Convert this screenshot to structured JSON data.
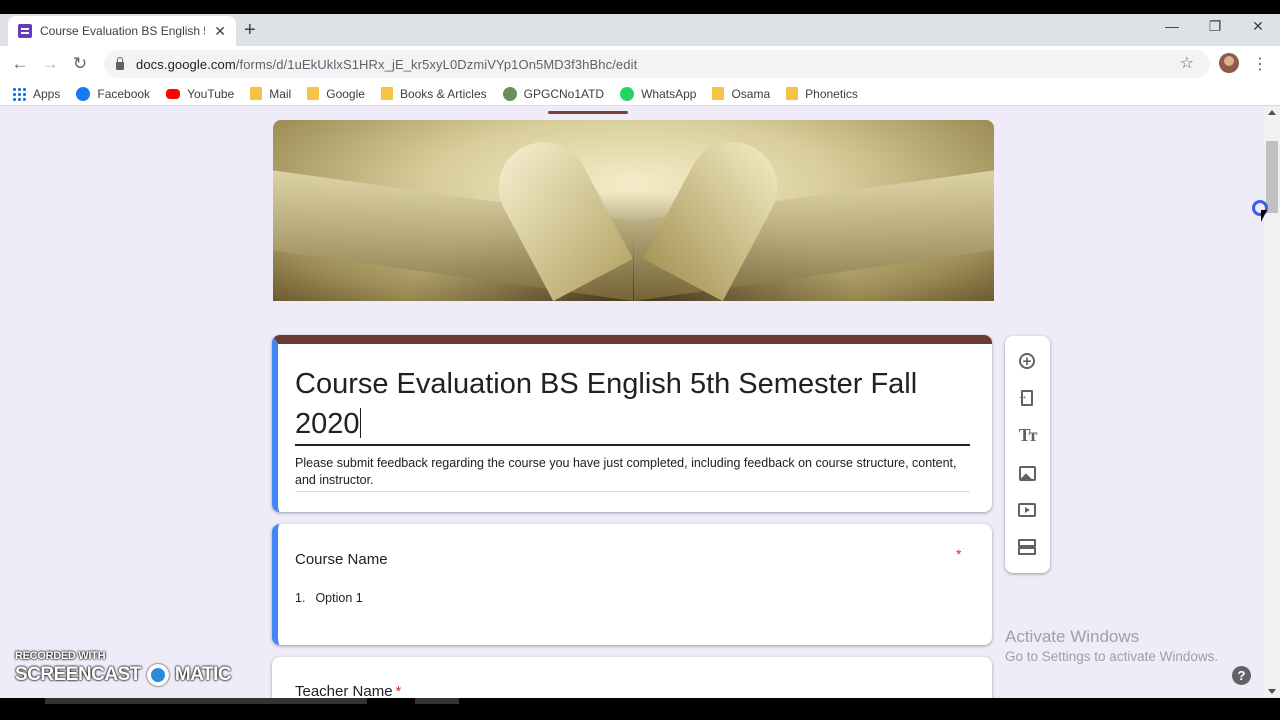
{
  "browser": {
    "tab_title": "Course Evaluation BS English 5th",
    "tab_close": "✕",
    "new_tab": "+",
    "window_min": "—",
    "window_restore": "❐",
    "window_close": "✕",
    "back": "←",
    "forward": "→",
    "reload": "↻",
    "url_host": "docs.google.com",
    "url_path": "/forms/d/1uEkUklxS1HRx_jE_kr5xyL0DzmiVYp1On5MD3f3hBhc/edit",
    "star": "☆",
    "menu": "⋮",
    "bookmarks": [
      {
        "label": "Apps",
        "icon": "apps-grid-icon"
      },
      {
        "label": "Facebook",
        "icon": "facebook-icon"
      },
      {
        "label": "YouTube",
        "icon": "youtube-icon"
      },
      {
        "label": "Mail",
        "icon": "folder-icon"
      },
      {
        "label": "Google",
        "icon": "folder-icon"
      },
      {
        "label": "Books & Articles",
        "icon": "folder-icon"
      },
      {
        "label": "GPGCNo1ATD",
        "icon": "site-icon"
      },
      {
        "label": "WhatsApp",
        "icon": "whatsapp-icon"
      },
      {
        "label": "Osama",
        "icon": "folder-icon"
      },
      {
        "label": "Phonetics",
        "icon": "folder-icon"
      }
    ]
  },
  "form": {
    "title": "Course Evaluation BS English 5th Semester Fall 2020",
    "description": "Please submit feedback regarding the course you have just completed, including feedback on course structure, content, and instructor.",
    "questions": [
      {
        "title": "Course Name",
        "required_mark": "*",
        "option_number": "1.",
        "option_label": "Option 1"
      },
      {
        "title": "Teacher Name",
        "required_mark": "*"
      }
    ],
    "theme_color": "#6d3b36",
    "accent_color": "#4285f4"
  },
  "sidebar": {
    "add_question": "+",
    "add_title_text": "Tт"
  },
  "overlay": {
    "activate_title": "Activate Windows",
    "activate_sub": "Go to Settings to activate Windows.",
    "help": "?",
    "watermark_small": "RECORDED WITH",
    "watermark_left": "SCREENCAST",
    "watermark_right": "MATIC"
  }
}
